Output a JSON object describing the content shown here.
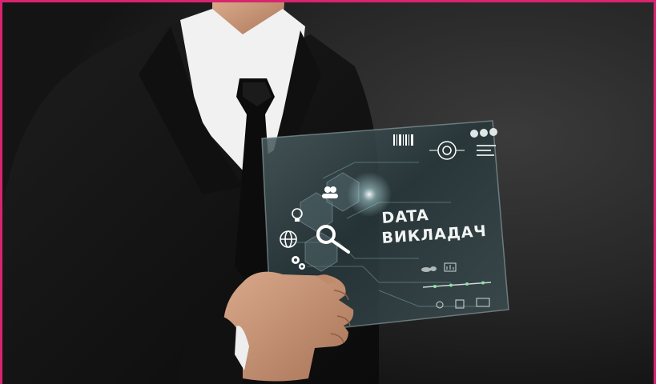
{
  "image": {
    "description_free": true
  },
  "tablet": {
    "title_line_1": "DATA",
    "title_line_2": "ВИКЛАДАЧ",
    "icons": [
      "users-icon",
      "lightbulb-icon",
      "globe-icon",
      "gears-icon",
      "magnifier-icon",
      "world-map-icon",
      "barcode-icon",
      "target-icon",
      "chart-icon"
    ]
  },
  "colors": {
    "frame_border": "#d9246f",
    "background": "#262626",
    "suit": "#151515",
    "shirt": "#f1f1f1",
    "tie": "#0c0c0c",
    "skin": "#c99577",
    "glass_panel": "#2e3b3e",
    "hud_text": "#f2f4f3"
  }
}
